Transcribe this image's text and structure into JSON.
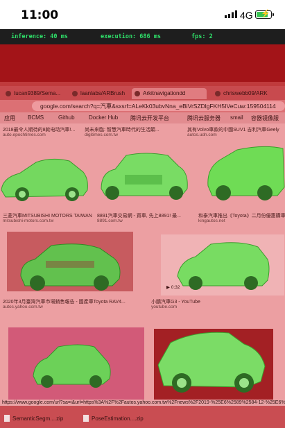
{
  "status_bar": {
    "time": "11:00",
    "network": "4G",
    "battery_level": 0.85,
    "battery_color": "#38c452",
    "signal_icon": "cellular-signal-icon",
    "battery_icon": "battery-charging-icon"
  },
  "metrics": {
    "inference": "inference: 40 ms",
    "execution": "execution: 686 ms",
    "fps": "fps: 2",
    "text_color": "#2fe06a"
  },
  "browser": {
    "tabs": [
      "tucan9389/Sema...",
      "laanlabs/ARBrush",
      "Arkitnavigationdd",
      "chriswebb09/ARK"
    ],
    "url": "google.com/search?q=汽車&sxsrf=ALeKk03ubvNna_eBiVrSZDlgFKH5IVeCuw:159504114",
    "bookmarks": [
      "应用",
      "BCMS",
      "Github",
      "Docker Hub",
      "腾讯云开发平台",
      "腾讯云服务器",
      "smail",
      "容器镜像服"
    ],
    "status_url": "https://www.google.com/url?sa=i&url=https%3A%2F%2Fautos.yahoo.com.tw%2Fnews%2F2019-%25E6%2589%2584-12-%25E6%25"
  },
  "results": [
    {
      "caption": "2018最令人期待的8款电动汽車!...",
      "source": "auto.epochtimes.com"
    },
    {
      "caption": "尚未來臨: 智慧汽車時代的生活顛...",
      "source": "digitimes.com.tw"
    },
    {
      "caption": "其有Volvo車款的中國SUV1 吉利汽車Geely",
      "source": "autos.udn.com"
    },
    {
      "caption": "三菱汽車MITSUBISHI MOTORS TAIWAN",
      "source": "mitsubishi-motors.com.tw"
    },
    {
      "caption": "8891汽車交易網 - 買車, 先上8891! 最...",
      "source": "8891.com.tw"
    },
    {
      "caption": "和泰汽車推出《Toyota》二月份優惠購車",
      "source": "kingautos.net"
    },
    {
      "caption": "2020年3月臺灣汽車市場銷售報告 - 國產車Toyota RAV4...",
      "source": "autos.yahoo.com.tw"
    },
    {
      "caption": "小鵬汽車G3 - YouTube",
      "source": "youtube.com"
    },
    {
      "caption": "",
      "source": ""
    },
    {
      "caption": "",
      "source": ""
    }
  ],
  "video_badge": "▶ 0:32",
  "downloads": [
    "SemanticSegm....zip",
    "PoseEstimation....zip"
  ],
  "overlay": {
    "background_class_color": "#ba2a2e",
    "car_class_color": "#6fdc5e"
  }
}
